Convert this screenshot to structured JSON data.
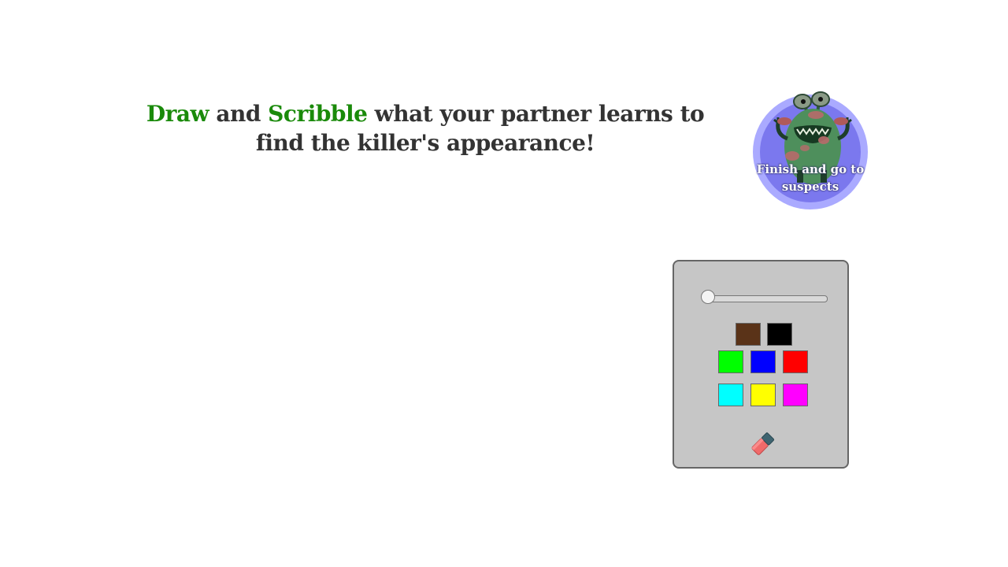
{
  "instruction": {
    "word1": "Draw",
    "word2": " and ",
    "word3": "Scribble",
    "rest": " what your partner learns to find the killer's appearance!"
  },
  "finish_button": {
    "label": "Finish and go to suspects",
    "icon": "monster-icon"
  },
  "toolbox": {
    "brush_size_fraction": 0,
    "colors": {
      "brown": "#5a3318",
      "black": "#000000",
      "green": "#00ff00",
      "blue": "#0000ff",
      "red": "#ff0000",
      "cyan": "#00ffff",
      "yellow": "#ffff00",
      "magenta": "#ff00ff"
    },
    "eraser_icon": "eraser-icon"
  },
  "colors": {
    "keyword": "#1a8a0a",
    "text": "#333333",
    "finish_outer": "#aaaaff",
    "finish_inner": "#7b78ee",
    "panel": "#c6c6c6"
  }
}
